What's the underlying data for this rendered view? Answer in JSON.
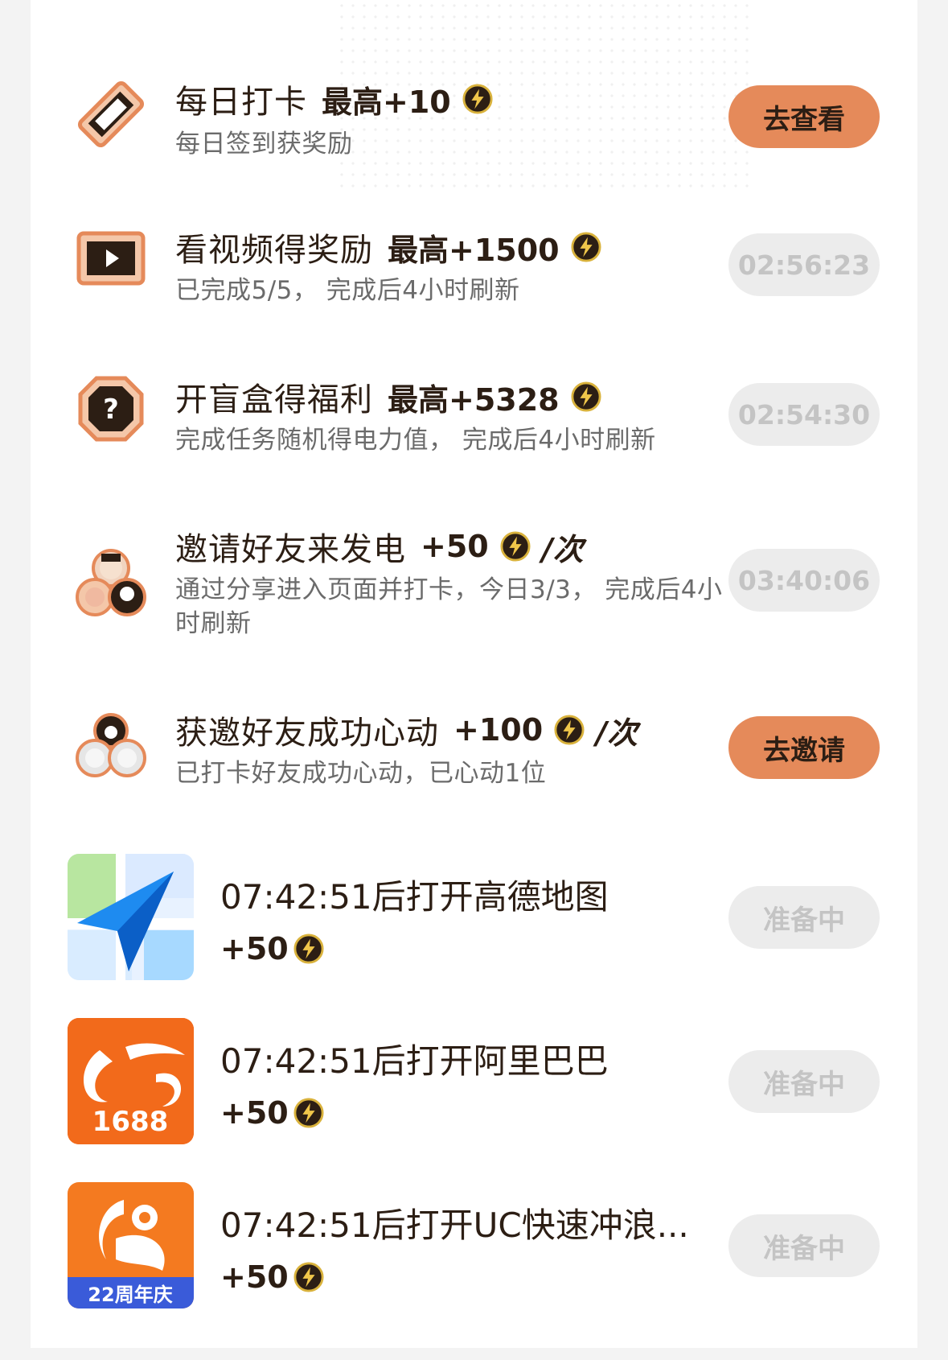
{
  "tasks": [
    {
      "title": "每日打卡",
      "reward": "最高+10",
      "subtitle": "每日签到获奖励",
      "button": "去查看",
      "button_kind": "primary",
      "icon": "ticket-icon"
    },
    {
      "title": "看视频得奖励",
      "reward": "最高+1500",
      "subtitle": "已完成5/5， 完成后4小时刷新",
      "button": "02:56:23",
      "button_kind": "timer",
      "icon": "video-play-icon"
    },
    {
      "title": "开盲盒得福利",
      "reward": "最高+5328",
      "subtitle": "完成任务随机得电力值， 完成后4小时刷新",
      "button": "02:54:30",
      "button_kind": "timer",
      "icon": "mystery-box-icon"
    },
    {
      "title": "邀请好友来发电",
      "reward": "+50",
      "per": "/次",
      "subtitle": "通过分享进入页面并打卡，今日3/3， 完成后4小时刷新",
      "button": "03:40:06",
      "button_kind": "timer",
      "icon": "friends-avatars-icon"
    },
    {
      "title": "获邀好友成功心动",
      "reward": "+100",
      "per": "/次",
      "subtitle": "已打卡好友成功心动，已心动1位",
      "button": "去邀请",
      "button_kind": "primary",
      "icon": "invited-friends-icon"
    }
  ],
  "apps": [
    {
      "title": "07:42:51后打开高德地图",
      "reward": "+50",
      "button": "准备中",
      "icon": "amap-app-icon"
    },
    {
      "title": "07:42:51后打开阿里巴巴",
      "reward": "+50",
      "button": "准备中",
      "icon": "alibaba-1688-app-icon",
      "icon_text": "1688"
    },
    {
      "title": "07:42:51后打开UC快速冲浪...",
      "reward": "+50",
      "button": "准备中",
      "icon": "uc-browser-app-icon",
      "icon_text": "22周年庆"
    }
  ],
  "colors": {
    "primary_button": "#e58a5a",
    "disabled_button": "#ececec",
    "text_dark": "#2c1e14",
    "text_muted": "#6b6b6b",
    "bolt_fill": "#2c1e14",
    "bolt_ring": "#d9b23c"
  }
}
